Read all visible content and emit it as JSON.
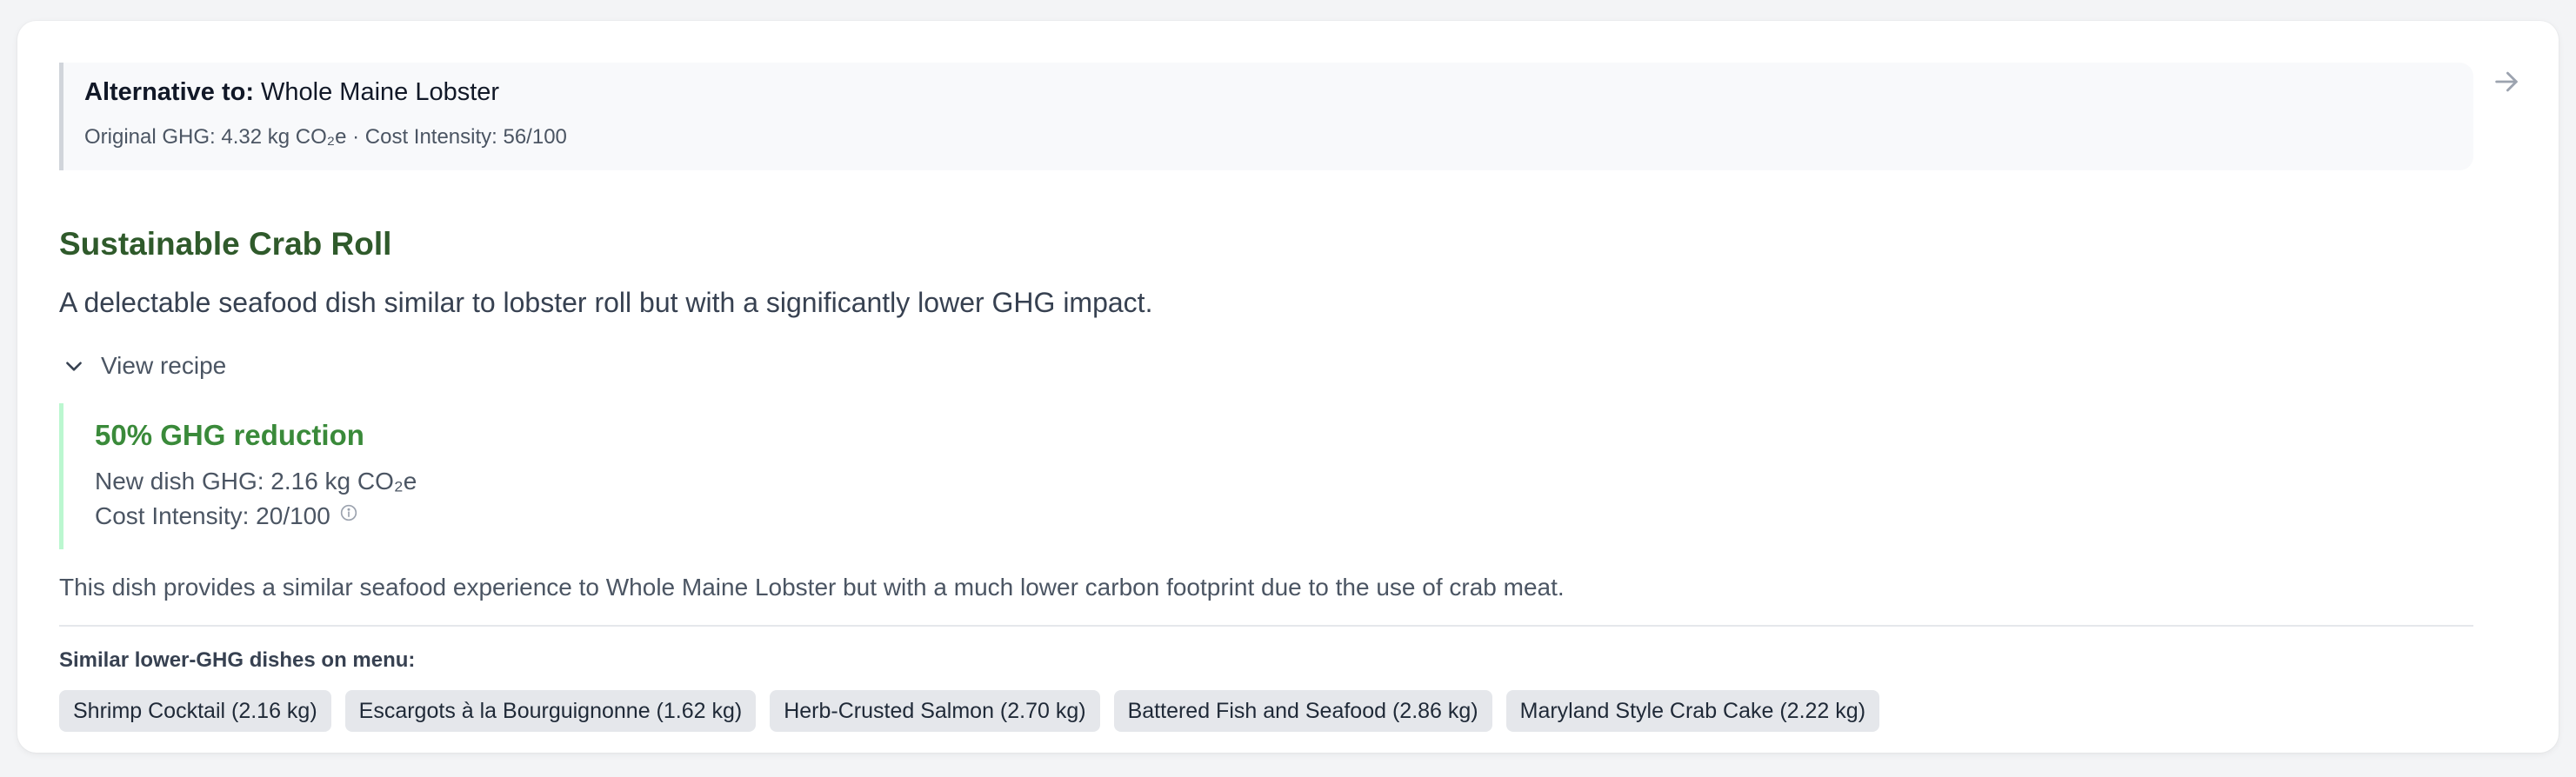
{
  "alternative": {
    "label": "Alternative to:",
    "original_name": "Whole Maine Lobster",
    "original_stats": "Original GHG: 4.32 kg CO₂e · Cost Intensity: 56/100"
  },
  "dish": {
    "title": "Sustainable Crab Roll",
    "description": "A delectable seafood dish similar to lobster roll but with a significantly lower GHG impact.",
    "view_recipe_label": "View recipe"
  },
  "impact": {
    "reduction_label": "50% GHG reduction",
    "new_ghg": "New dish GHG: 2.16 kg CO₂e",
    "cost_intensity": "Cost Intensity: 20/100"
  },
  "explanation": "This dish provides a similar seafood experience to Whole Maine Lobster but with a much lower carbon footprint due to the use of crab meat.",
  "similar": {
    "label": "Similar lower-GHG dishes on menu:",
    "dishes": [
      "Shrimp Cocktail (2.16 kg)",
      "Escargots à la Bourguignonne (1.62 kg)",
      "Herb-Crusted Salmon (2.70 kg)",
      "Battered Fish and Seafood (2.86 kg)",
      "Maryland Style Crab Cake (2.22 kg)"
    ]
  },
  "icons": {
    "next": "arrow-right-icon",
    "expand": "chevron-down-icon",
    "info": "info-icon"
  },
  "colors": {
    "title_green": "#2f5a2b",
    "reduction_green": "#3a8a3a",
    "accent_border": "#bbf7d0",
    "chip_bg": "#e5e7eb"
  }
}
